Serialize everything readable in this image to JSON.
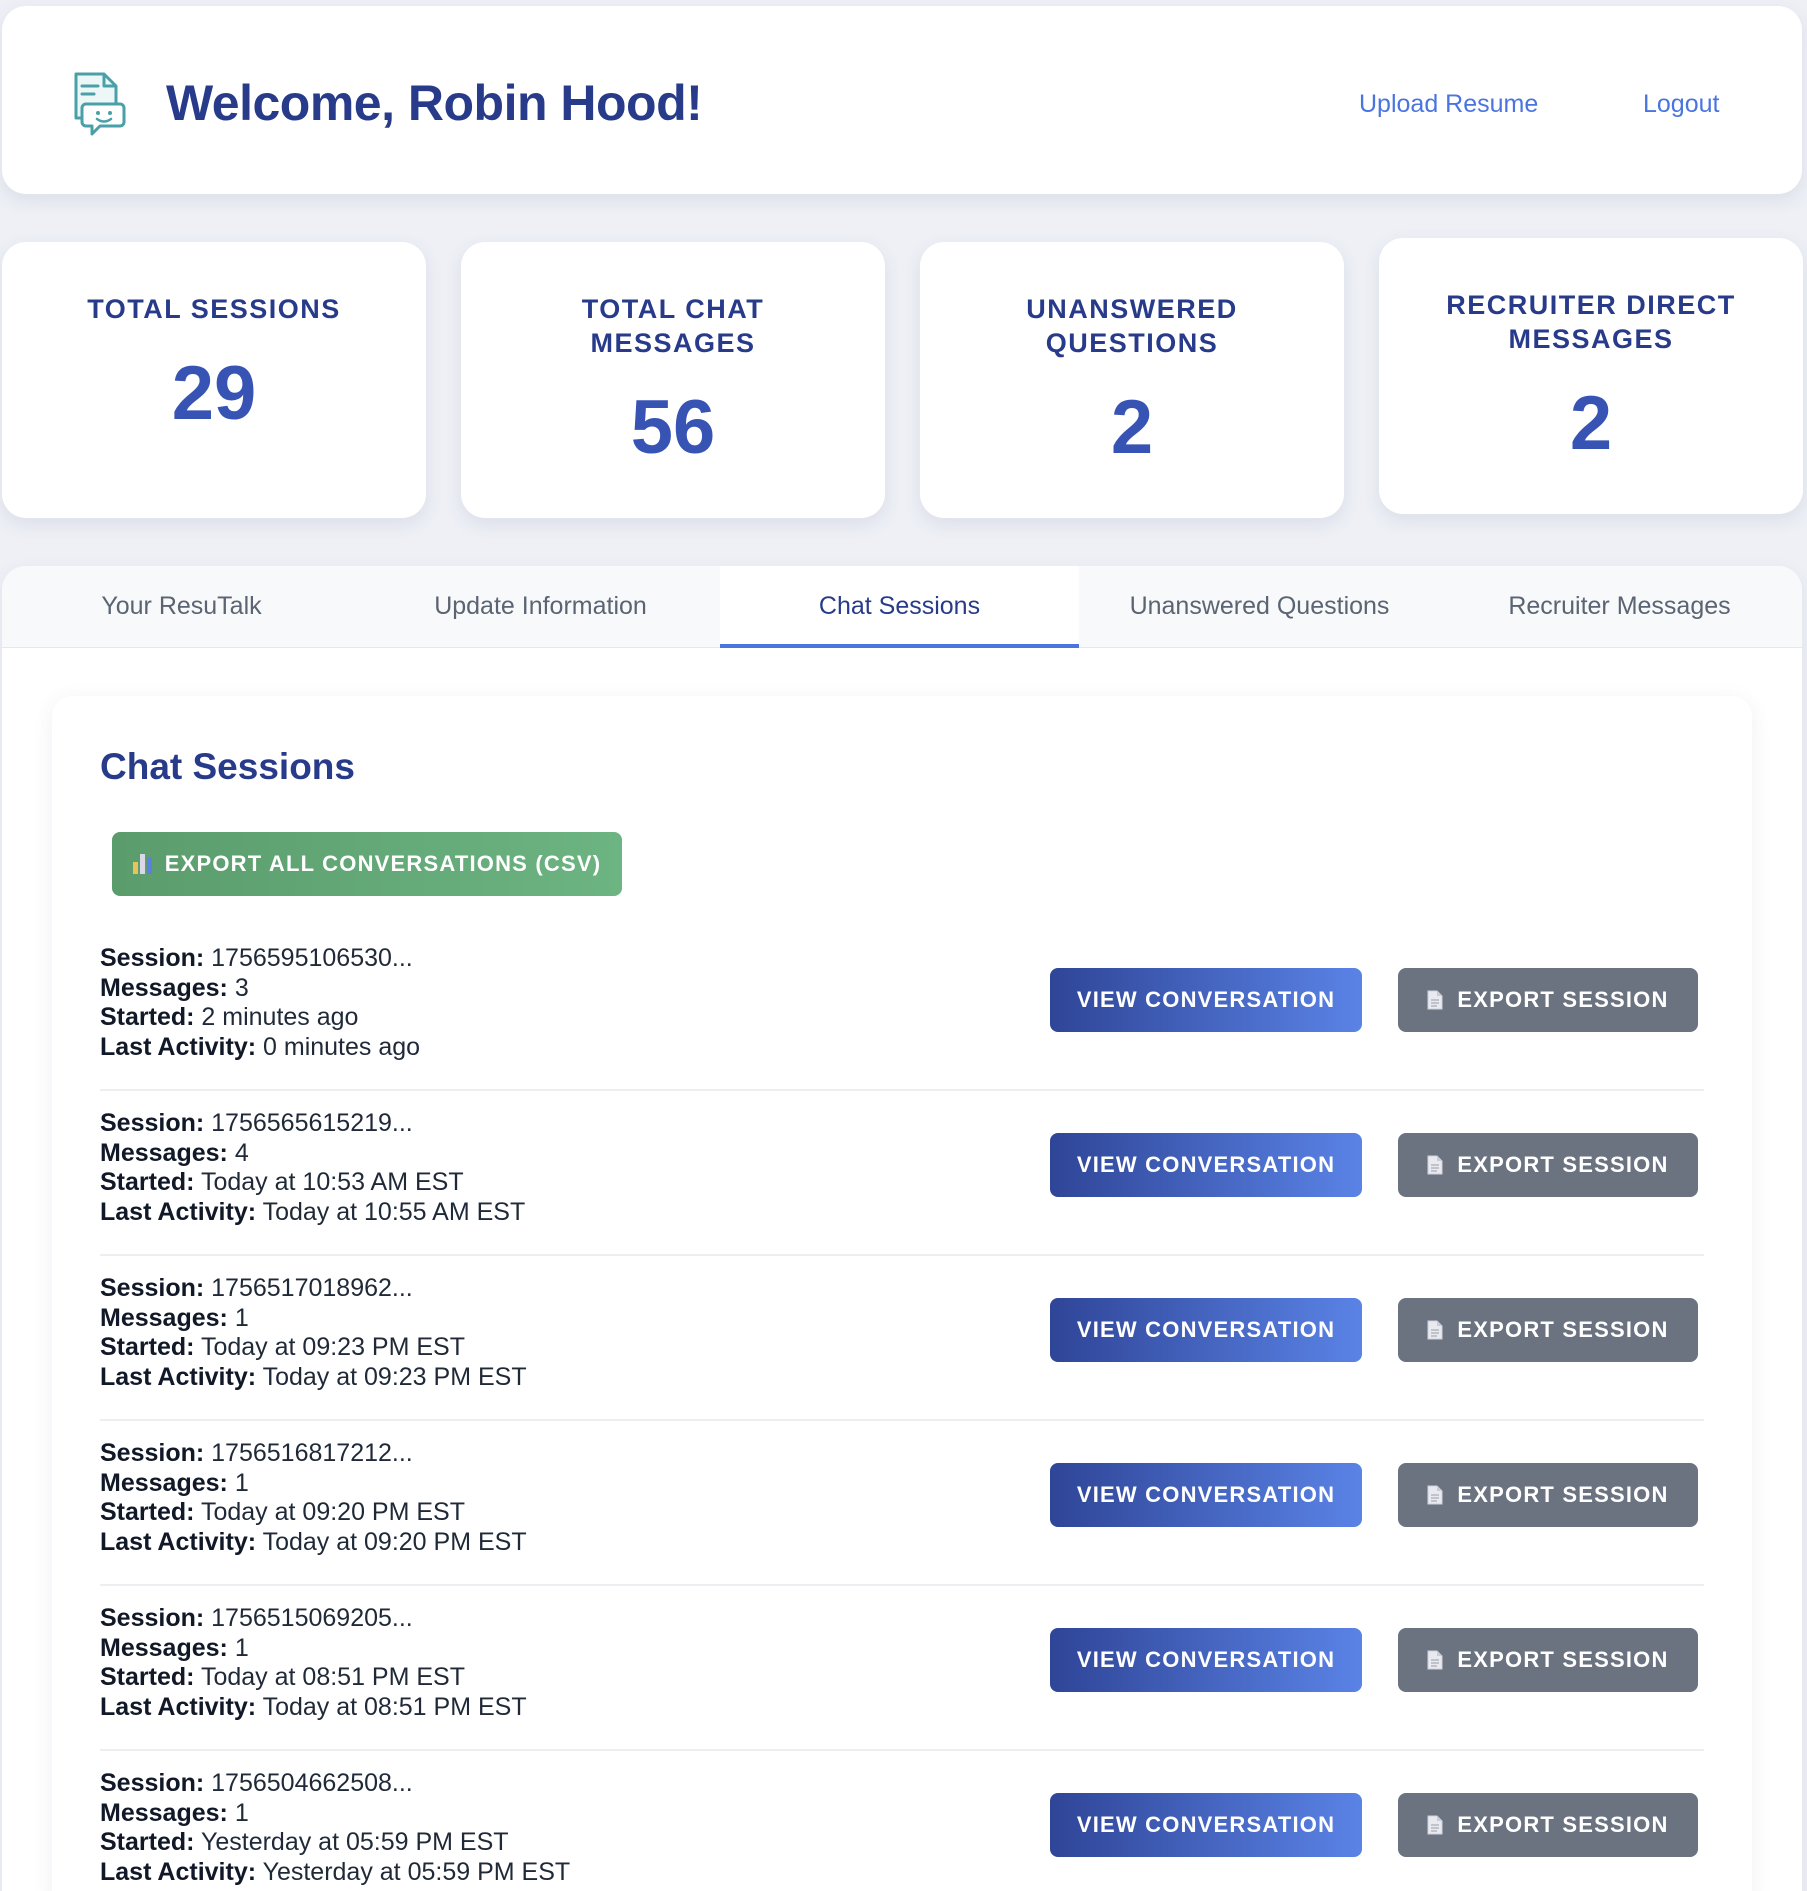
{
  "header": {
    "welcome": "Welcome, Robin Hood!",
    "nav": {
      "upload": "Upload Resume",
      "logout": "Logout"
    }
  },
  "stats": [
    {
      "label": "TOTAL SESSIONS",
      "value": "29"
    },
    {
      "label": "TOTAL CHAT MESSAGES",
      "value": "56"
    },
    {
      "label": "UNANSWERED QUESTIONS",
      "value": "2"
    },
    {
      "label": "RECRUITER DIRECT MESSAGES",
      "value": "2"
    }
  ],
  "tabs": [
    {
      "label": "Your ResuTalk"
    },
    {
      "label": "Update Information"
    },
    {
      "label": "Chat Sessions",
      "active": true
    },
    {
      "label": "Unanswered Questions"
    },
    {
      "label": "Recruiter Messages"
    }
  ],
  "chat_sessions": {
    "title": "Chat Sessions",
    "export_all": "EXPORT ALL CONVERSATIONS (CSV)",
    "labels": {
      "session": "Session:",
      "messages": "Messages:",
      "started": "Started:",
      "last_activity": "Last Activity:",
      "view": "VIEW CONVERSATION",
      "export": "EXPORT SESSION"
    },
    "sessions": [
      {
        "id": "1756595106530...",
        "messages": "3",
        "started": "2 minutes ago",
        "last_activity": "0 minutes ago"
      },
      {
        "id": "1756565615219...",
        "messages": "4",
        "started": "Today at 10:53 AM EST",
        "last_activity": "Today at 10:55 AM EST"
      },
      {
        "id": "1756517018962...",
        "messages": "1",
        "started": "Today at 09:23 PM EST",
        "last_activity": "Today at 09:23 PM EST"
      },
      {
        "id": "1756516817212...",
        "messages": "1",
        "started": "Today at 09:20 PM EST",
        "last_activity": "Today at 09:20 PM EST"
      },
      {
        "id": "1756515069205...",
        "messages": "1",
        "started": "Today at 08:51 PM EST",
        "last_activity": "Today at 08:51 PM EST"
      },
      {
        "id": "1756504662508...",
        "messages": "1",
        "started": "Yesterday at 05:59 PM EST",
        "last_activity": "Yesterday at 05:59 PM EST"
      }
    ]
  },
  "colors": {
    "brand": "#283b8a",
    "accent": "#4a74e0",
    "export_green": "#5b9c6c",
    "export_gray": "#6b7280"
  },
  "icons": {
    "logo": "resume-chat-icon",
    "export_all": "bar-chart-icon",
    "export_session": "document-icon"
  }
}
